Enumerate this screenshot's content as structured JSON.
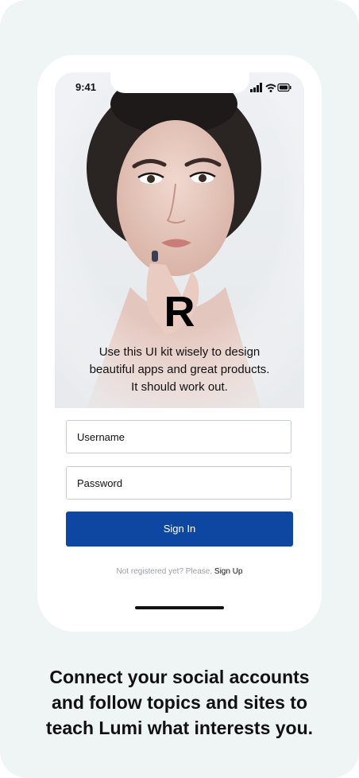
{
  "status_bar": {
    "time": "9:41"
  },
  "login": {
    "logo": "R",
    "tagline_lines": [
      "Use this UI kit wisely to design",
      "beautiful apps and great products.",
      "It should work out."
    ],
    "username_placeholder": "Username",
    "password_placeholder": "Password",
    "signin_label": "Sign In",
    "register_prompt": "Not registered yet? Please,",
    "register_link": "Sign Up"
  },
  "caption_lines": [
    "Connect your social accounts",
    "and follow topics and sites to",
    "teach Lumi what interests you."
  ],
  "colors": {
    "primary": "#0d47a1",
    "background": "#eef5f4"
  }
}
